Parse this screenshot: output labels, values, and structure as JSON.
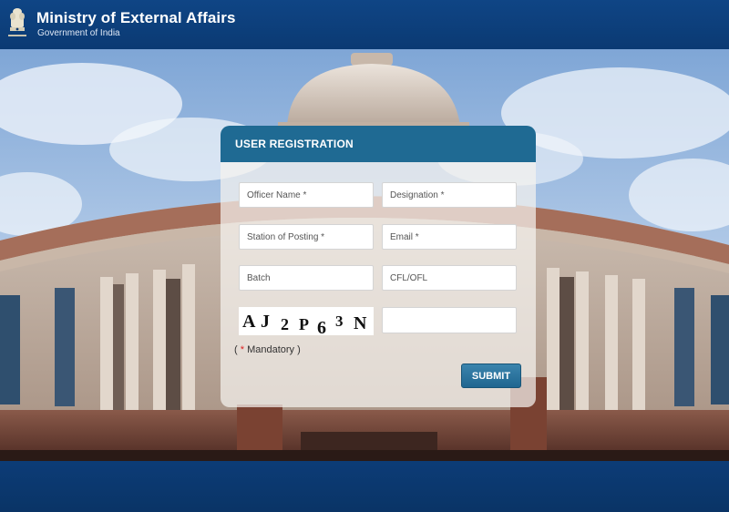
{
  "header": {
    "title": "Ministry of External Affairs",
    "subtitle": "Government of India"
  },
  "panel": {
    "title": "USER REGISTRATION"
  },
  "form": {
    "officer_name_placeholder": "Officer Name *",
    "designation_placeholder": "Designation *",
    "station_placeholder": "Station of Posting *",
    "email_placeholder": "Email *",
    "batch_placeholder": "Batch",
    "cfl_placeholder": "CFL/OFL",
    "captcha_input_value": "",
    "mandatory_open": "(",
    "mandatory_star": "*",
    "mandatory_text": " Mandatory )",
    "submit_label": "SUBMIT"
  },
  "captcha": {
    "text": "AJ2P63N",
    "chars": [
      "A",
      "J",
      "2",
      "P",
      "6",
      "3",
      "N"
    ]
  },
  "colors": {
    "header_bg": "#0c3a72",
    "panel_header": "#1f6a93",
    "submit_bg": "#2a75a0",
    "mandatory_star": "#dd2222"
  },
  "icons": {
    "emblem": "national-emblem-icon"
  }
}
